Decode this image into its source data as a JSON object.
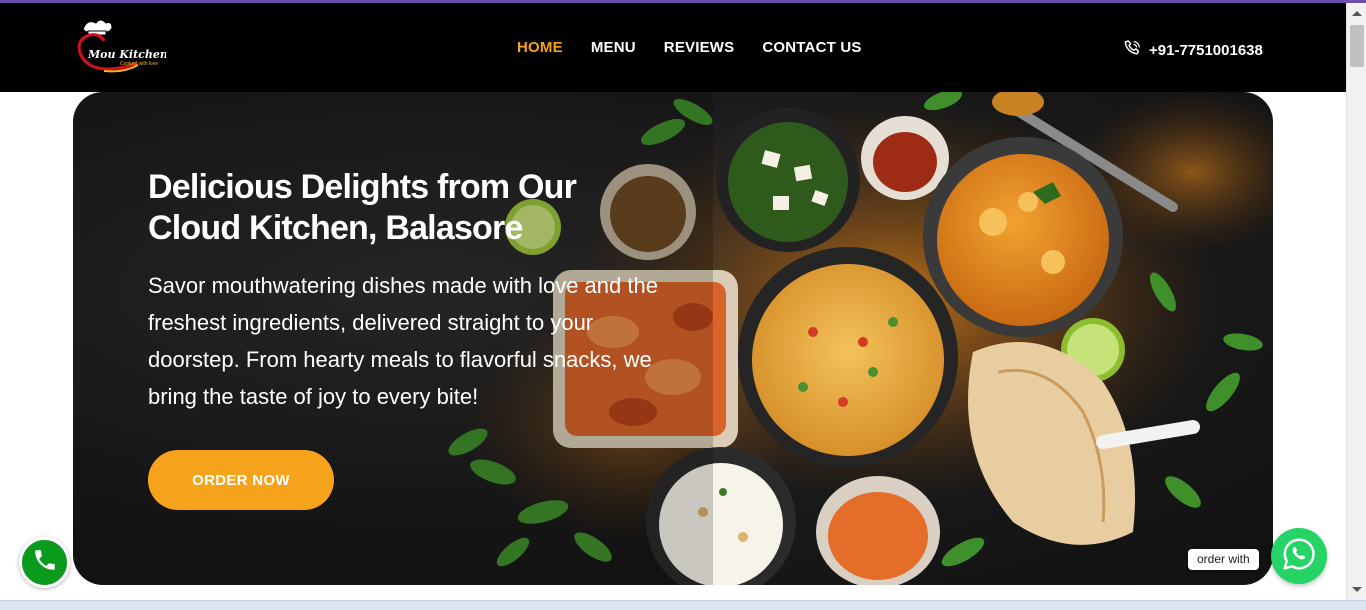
{
  "brand": {
    "name": "Mou Kitchen",
    "tagline": "Cooked with love",
    "colors": {
      "accent": "#f7a21b",
      "navbar": "#000000",
      "call": "#0a9a1c",
      "whatsapp": "#25d366"
    }
  },
  "nav": {
    "items": [
      {
        "label": "HOME",
        "active": true
      },
      {
        "label": "MENU",
        "active": false
      },
      {
        "label": "REVIEWS",
        "active": false
      },
      {
        "label": "CONTACT US",
        "active": false
      }
    ],
    "phone": {
      "icon": "phone-icon",
      "number": "+91-7751001638"
    }
  },
  "hero": {
    "title": "Delicious Delights from Our Cloud Kitchen, Balasore",
    "description": "Savor mouthwatering dishes made with love and the freshest ingredients, delivered straight to your doorstep. From hearty meals to flavorful snacks, we bring the taste of joy to every bite!",
    "cta_label": "ORDER NOW"
  },
  "floating": {
    "call_icon": "phone-icon",
    "order_with_label": "order with",
    "whatsapp_icon": "whatsapp-icon"
  }
}
